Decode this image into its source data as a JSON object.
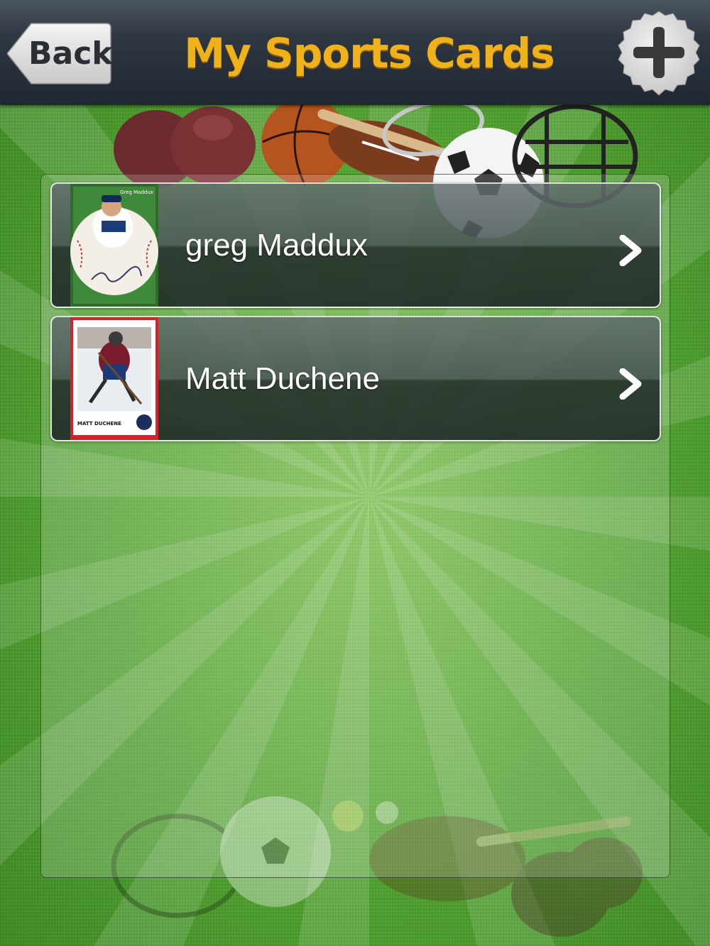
{
  "header": {
    "back_label": "Back",
    "title": "My Sports Cards",
    "add_icon": "plus-icon"
  },
  "cards": [
    {
      "name": "greg Maddux",
      "thumbnail": "baseball-card-thumbnail",
      "thumbnail_text": "Greg Maddux",
      "chevron_icon": "chevron-right-icon"
    },
    {
      "name": "Matt Duchene",
      "thumbnail": "hockey-card-thumbnail",
      "thumbnail_text": "MATT DUCHENE",
      "chevron_icon": "chevron-right-icon"
    }
  ],
  "colors": {
    "title": "#f0b21a",
    "navbar": "#2e3742",
    "grass": "#56a832"
  }
}
